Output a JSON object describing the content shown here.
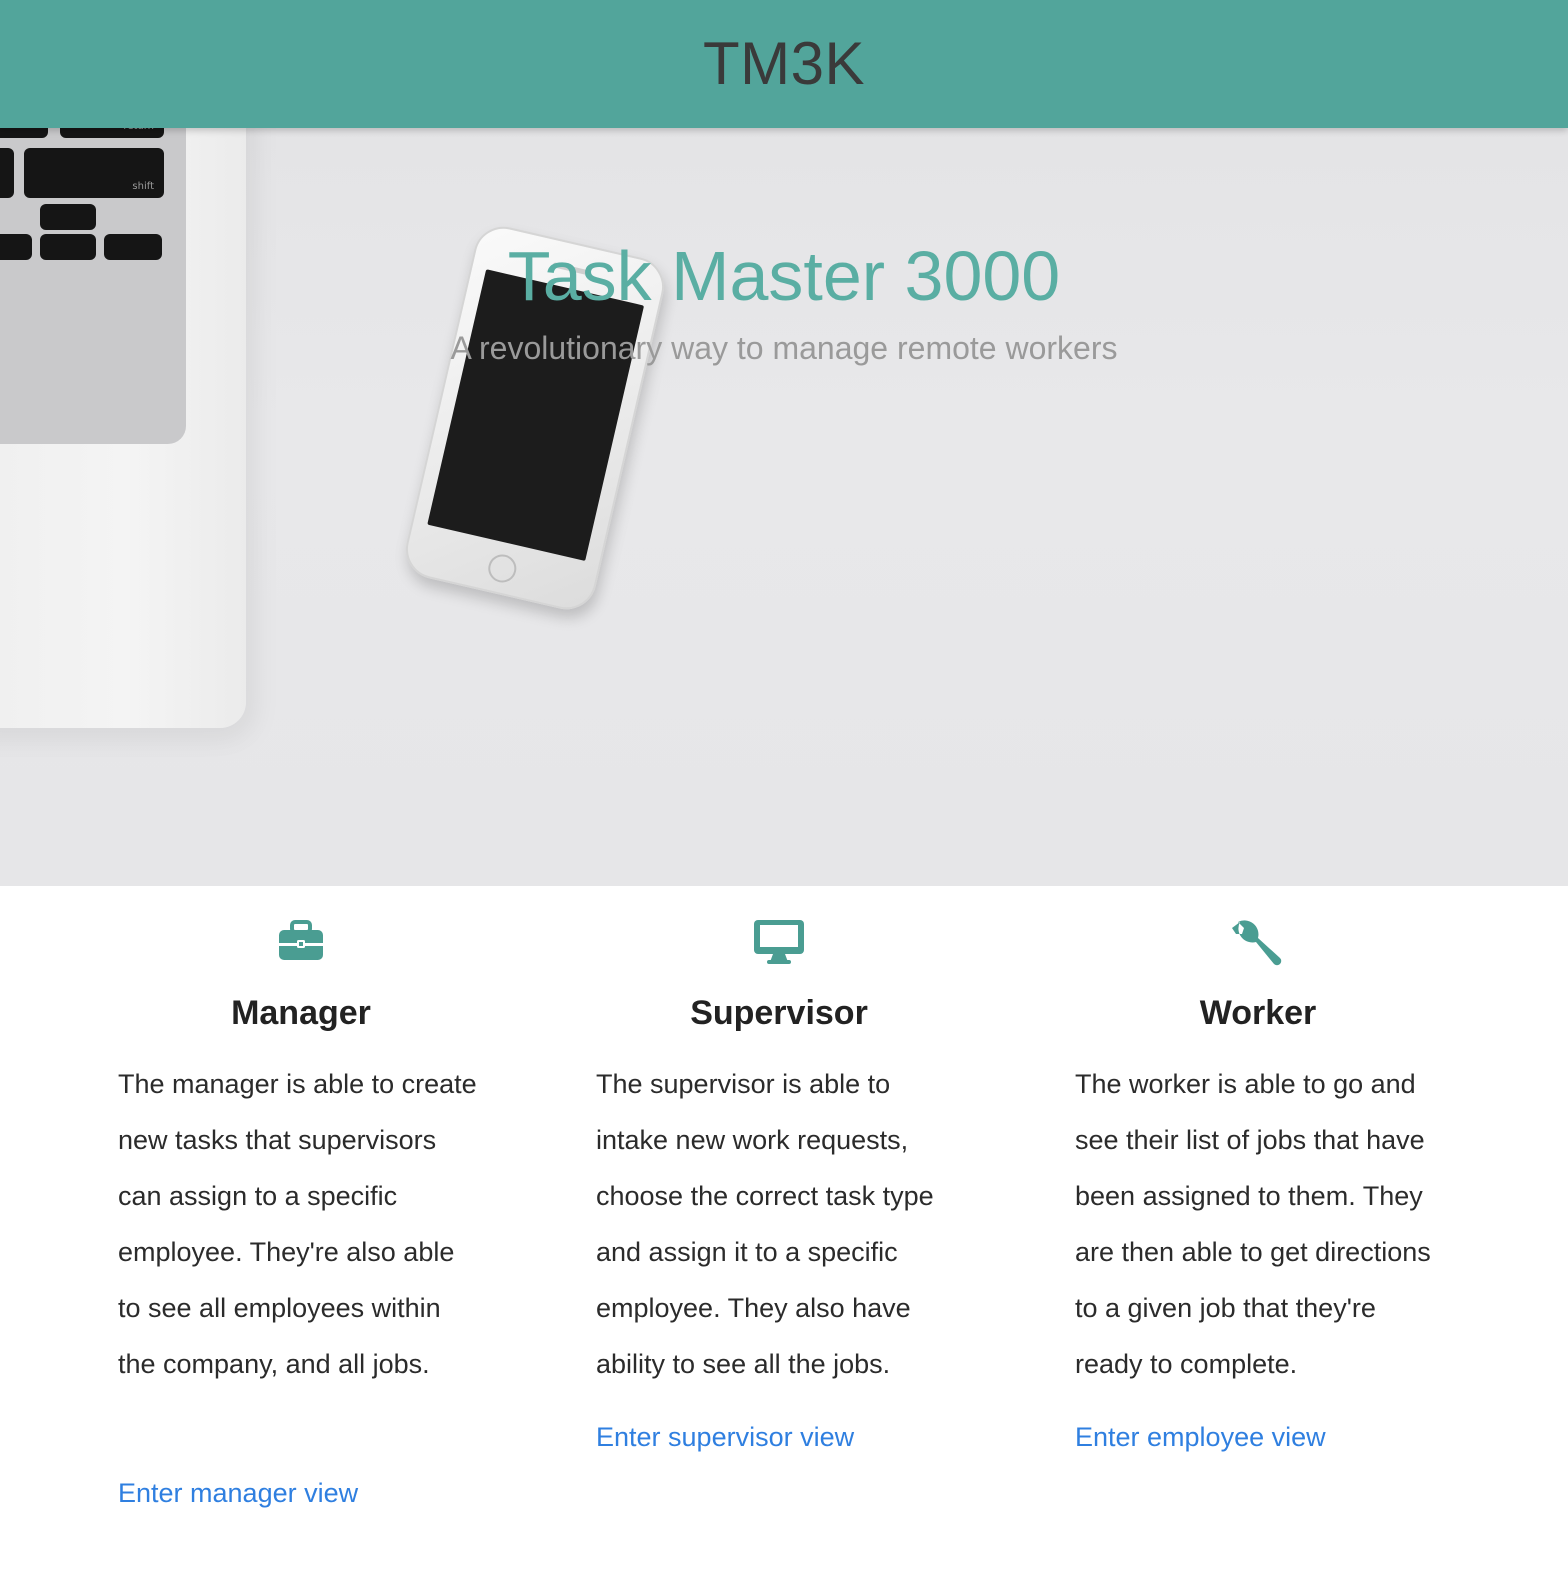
{
  "header": {
    "brand": "TM3K"
  },
  "hero": {
    "title": "Task Master 3000",
    "subtitle": "A revolutionary way to manage remote workers",
    "keycaps": [
      "return",
      "shift"
    ]
  },
  "roles": [
    {
      "icon": "briefcase-icon",
      "title": "Manager",
      "description": "The manager is able to create new tasks that supervisors can assign to a specific employee. They're also able to see all employees within the company, and all jobs.",
      "link": "Enter manager view"
    },
    {
      "icon": "desktop-icon",
      "title": "Supervisor",
      "description": "The supervisor is able to intake new work requests, choose the correct task type and assign it to a specific employee. They also have ability to see all the jobs.",
      "link": "Enter supervisor view"
    },
    {
      "icon": "wrench-icon",
      "title": "Worker",
      "description": "The worker is able to go and see their list of jobs that have been assigned to them. They are then able to get directions to a given job that they're ready to complete.",
      "link": "Enter employee view"
    }
  ],
  "colors": {
    "header_bg": "#52a59b",
    "accent": "#5aaea3",
    "icon": "#4a9d92",
    "link": "#2f7fe0"
  }
}
